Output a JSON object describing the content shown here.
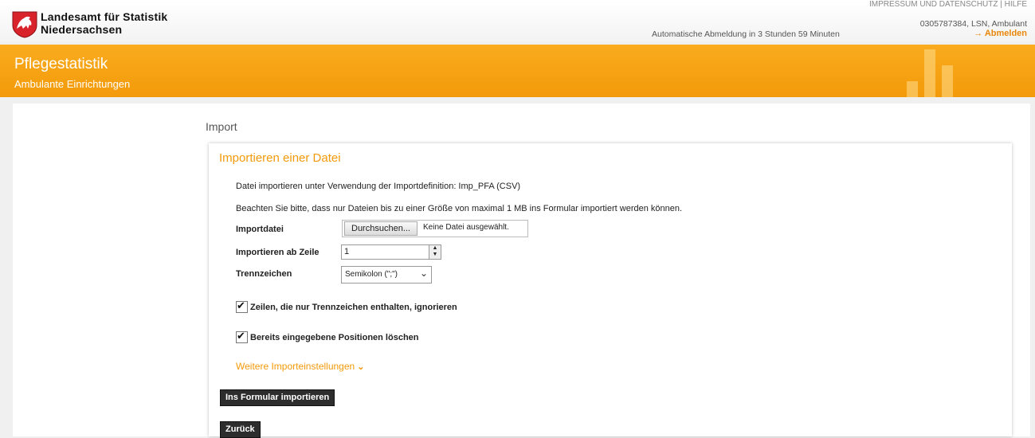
{
  "header": {
    "org_line1": "Landesamt für Statistik",
    "org_line2": "Niedersachsen",
    "top_links": "IMPRESSUM UND DATENSCHUTZ  |  HILFE",
    "auto_logout": "Automatische Abmeldung in 3 Stunden 59 Minuten",
    "user_info": "0305787384, LSN, Ambulant",
    "logout_label": "→ Abmelden"
  },
  "banner": {
    "title": "Pflegestatistik",
    "subtitle": "Ambulante Einrichtungen"
  },
  "page": {
    "title": "Import"
  },
  "panel": {
    "title": "Importieren einer Datei",
    "info_line1": "Datei importieren unter Verwendung der Importdefinition: Imp_PFA (CSV)",
    "info_line2": "Beachten Sie bitte, dass nur Dateien bis zu einer Größe von maximal 1 MB ins Formular importiert werden können.",
    "file_label": "Importdatei",
    "file_button": "Durchsuchen...",
    "file_status": "Keine Datei ausgewählt.",
    "start_row_label": "Importieren ab Zeile",
    "start_row_value": "1",
    "separator_label": "Trennzeichen",
    "separator_value": "Semikolon (\";\")",
    "ignore_separator_rows_label": "Zeilen, die nur Trennzeichen enthalten, ignorieren",
    "ignore_separator_rows_checked": true,
    "delete_positions_label": "Bereits eingegebene Positionen löschen",
    "delete_positions_checked": true,
    "more_settings_label": "Weitere Importeinstellungen",
    "import_button": "Ins Formular importieren",
    "back_button": "Zurück"
  },
  "colors": {
    "accent": "#f39a0a",
    "dark_button": "#2d2d2d"
  }
}
